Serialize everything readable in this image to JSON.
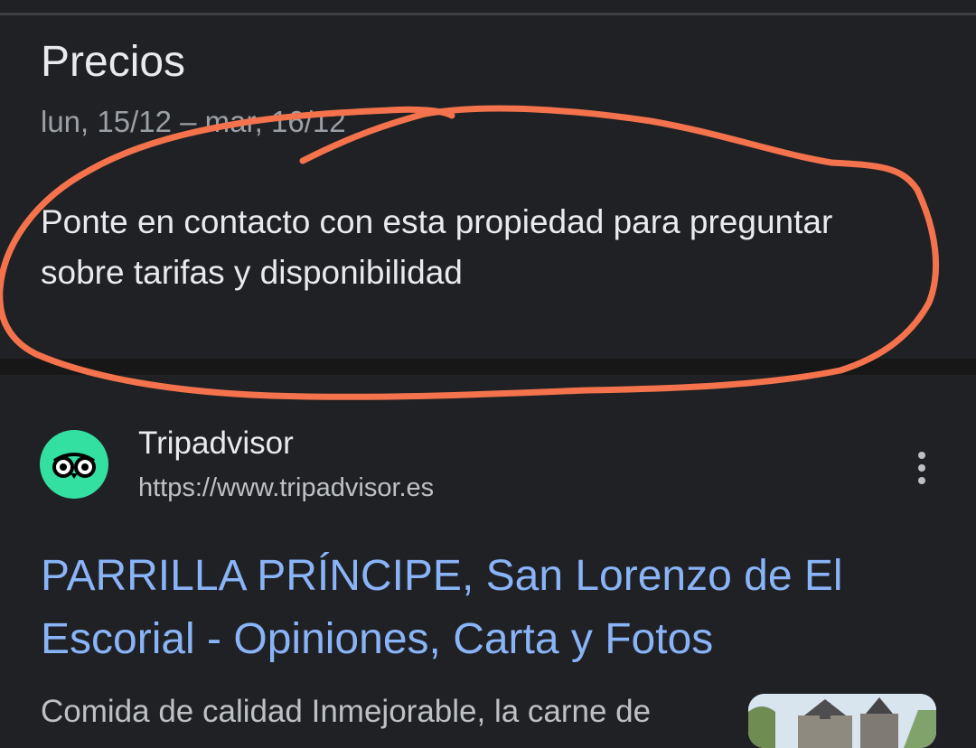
{
  "prices": {
    "title": "Precios",
    "date_range": "lun, 15/12 – mar, 16/12",
    "message": "Ponte en contacto con esta propiedad para preguntar sobre tarifas y disponibilidad"
  },
  "result": {
    "site_name": "Tripadvisor",
    "url": "https://www.tripadvisor.es",
    "title": "PARRILLA PRÍNCIPE, San Lorenzo de El Escorial - Opiniones, Carta y Fotos",
    "snippet": "Comida de calidad Inmejorable, la carne de",
    "logo_icon": "tripadvisor-owl-icon",
    "more_icon": "more-vert-icon",
    "thumbnail": "building-photo"
  },
  "colors": {
    "background": "#202124",
    "divider": "#171717",
    "link": "#8ab4f8",
    "secondary_text": "#9aa0a6",
    "brand_green": "#34e0a1",
    "annotation": "#f4734d"
  }
}
